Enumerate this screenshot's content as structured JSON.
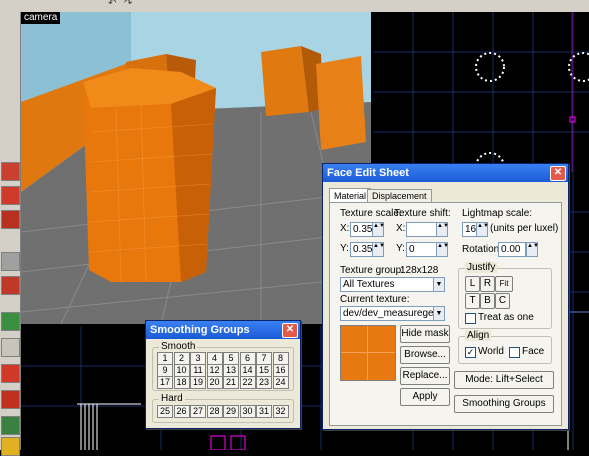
{
  "camera": {
    "label": "camera"
  },
  "face_edit": {
    "title": "Face Edit Sheet",
    "tabs": [
      "Material",
      "Displacement"
    ],
    "texture_scale_label": "Texture scale:",
    "texture_shift_label": "Texture shift:",
    "scale_x_label": "X:",
    "scale_x": "0.35",
    "scale_y_label": "Y:",
    "scale_y": "0.35",
    "shift_x_label": "X:",
    "shift_x": "",
    "shift_y_label": "Y:",
    "shift_y": "0",
    "lightmap_label": "Lightmap scale:",
    "lightmap_value": "16",
    "lightmap_units": "(units per luxel)",
    "rotation_label": "Rotation:",
    "rotation_value": "0.00",
    "texture_group_label": "Texture group:",
    "texture_size": "128x128",
    "texture_group_value": "All Textures",
    "current_texture_label": "Current texture:",
    "current_texture_value": "dev/dev_measuregenen",
    "justify_label": "Justify",
    "justify_buttons": [
      "L",
      "R",
      "Fit",
      "T",
      "B",
      "C"
    ],
    "treat_as_one": "Treat as one",
    "align_label": "Align",
    "align_world": "World",
    "align_face": "Face",
    "hide_mask": "Hide mask",
    "browse": "Browse...",
    "replace": "Replace...",
    "apply": "Apply",
    "mode": "Mode: Lift+Select",
    "smoothing_groups": "Smoothing Groups"
  },
  "smoothing": {
    "title": "Smoothing Groups",
    "smooth_label": "Smooth",
    "hard_label": "Hard",
    "smooth_numbers": [
      "1",
      "2",
      "3",
      "4",
      "5",
      "6",
      "7",
      "8",
      "9",
      "10",
      "11",
      "12",
      "13",
      "14",
      "15",
      "16",
      "17",
      "18",
      "19",
      "20",
      "21",
      "22",
      "23",
      "24"
    ],
    "hard_numbers": [
      "25",
      "26",
      "27",
      "28",
      "29",
      "30",
      "31",
      "32"
    ]
  }
}
